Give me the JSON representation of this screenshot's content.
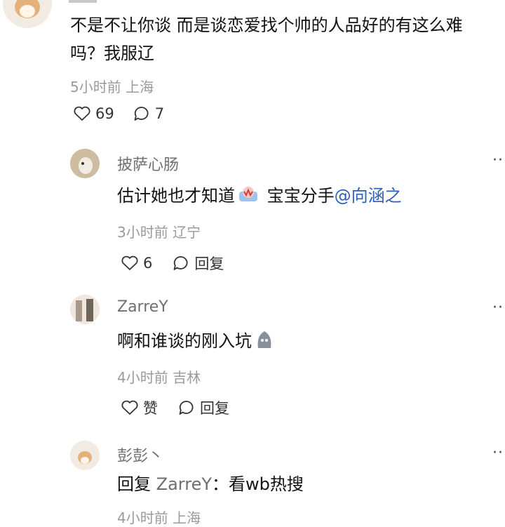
{
  "main_comment": {
    "text_line1": "不是不让你谈 而是谈恋爱找个帅的人品好的有这么难",
    "text_line2": "吗？我服辽",
    "meta": "5小时前 上海",
    "likes": "69",
    "replies": "7"
  },
  "replies": [
    {
      "author": "披萨心肠",
      "text": "估计她也才知道",
      "text_after_emoji": " 宝宝分手",
      "mention": "@向涵之",
      "meta": "3小时前 辽宁",
      "likes": "6",
      "reply_label": "回复",
      "emoji_icon": "crying-emoji"
    },
    {
      "author": "ZarreY",
      "text": "啊和谁谈的刚入坑",
      "meta": "4小时前 吉林",
      "likes": "赞",
      "reply_label": "回复",
      "emoji_icon": "doge-emoji"
    },
    {
      "author": "彭彭丶",
      "text_prefix": "回复 ",
      "reply_to": "ZarreY",
      "text": "：看wb热搜",
      "meta": "4小时前 上海"
    }
  ],
  "colors": {
    "meta": "#9a9a9a",
    "mention": "#2b5fb8",
    "author": "#6f6f6f"
  }
}
